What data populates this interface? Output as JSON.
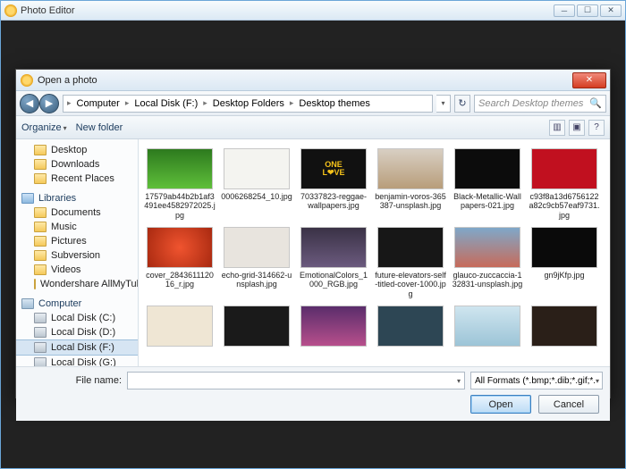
{
  "app": {
    "title": "Photo Editor",
    "minimize": "─",
    "maximize": "☐",
    "close": "✕"
  },
  "dialog": {
    "title": "Open a photo",
    "close": "✕",
    "nav": {
      "back": "◀",
      "fwd": "▶",
      "crumbs": [
        "Computer",
        "Local Disk (F:)",
        "Desktop Folders",
        "Desktop themes"
      ],
      "refresh": "↻"
    },
    "search": {
      "placeholder": "Search Desktop themes",
      "icon": "🔍"
    },
    "toolbar": {
      "organize": "Organize",
      "newfolder": "New folder",
      "view": "▥",
      "pane": "▣",
      "help": "?"
    },
    "sidebar": {
      "quick": [
        {
          "label": "Desktop",
          "icon": "fold"
        },
        {
          "label": "Downloads",
          "icon": "fold"
        },
        {
          "label": "Recent Places",
          "icon": "fold"
        }
      ],
      "libraries_head": "Libraries",
      "libraries": [
        {
          "label": "Documents",
          "icon": "fold"
        },
        {
          "label": "Music",
          "icon": "fold"
        },
        {
          "label": "Pictures",
          "icon": "fold"
        },
        {
          "label": "Subversion",
          "icon": "fold"
        },
        {
          "label": "Videos",
          "icon": "fold"
        },
        {
          "label": "Wondershare AllMyTube",
          "icon": "fold"
        }
      ],
      "computer_head": "Computer",
      "drives": [
        {
          "label": "Local Disk (C:)",
          "icon": "drv",
          "sel": false
        },
        {
          "label": "Local Disk (D:)",
          "icon": "drv",
          "sel": false
        },
        {
          "label": "Local Disk (F:)",
          "icon": "drv",
          "sel": true
        },
        {
          "label": "Local Disk (G:)",
          "icon": "drv",
          "sel": false
        }
      ]
    },
    "files": [
      {
        "name": "17579ab44b2b1af3491ee4582972025.jpg"
      },
      {
        "name": "0006268254_10.jpg"
      },
      {
        "name": "70337823-reggae-wallpapers.jpg",
        "overlay": "ONE\nL❤VE"
      },
      {
        "name": "benjamin-voros-365387-unsplash.jpg"
      },
      {
        "name": "Black-Metallic-Wallpapers-021.jpg"
      },
      {
        "name": "c93f8a13d6756122a82c9cb57eaf9731.jpg"
      },
      {
        "name": "cover_284361112016_r.jpg"
      },
      {
        "name": "echo-grid-314662-unsplash.jpg"
      },
      {
        "name": "EmotionalColors_1000_RGB.jpg"
      },
      {
        "name": "future-elevators-self-titled-cover-1000.jpg"
      },
      {
        "name": "glauco-zuccaccia-132831-unsplash.jpg"
      },
      {
        "name": "gn9jKfp.jpg"
      },
      {
        "name": ""
      },
      {
        "name": ""
      },
      {
        "name": ""
      },
      {
        "name": ""
      },
      {
        "name": ""
      },
      {
        "name": ""
      }
    ],
    "footer": {
      "filename_label": "File name:",
      "filename_value": "",
      "filter": "All Formats (*.bmp;*.dib;*.gif;*.",
      "open": "Open",
      "cancel": "Cancel"
    }
  }
}
